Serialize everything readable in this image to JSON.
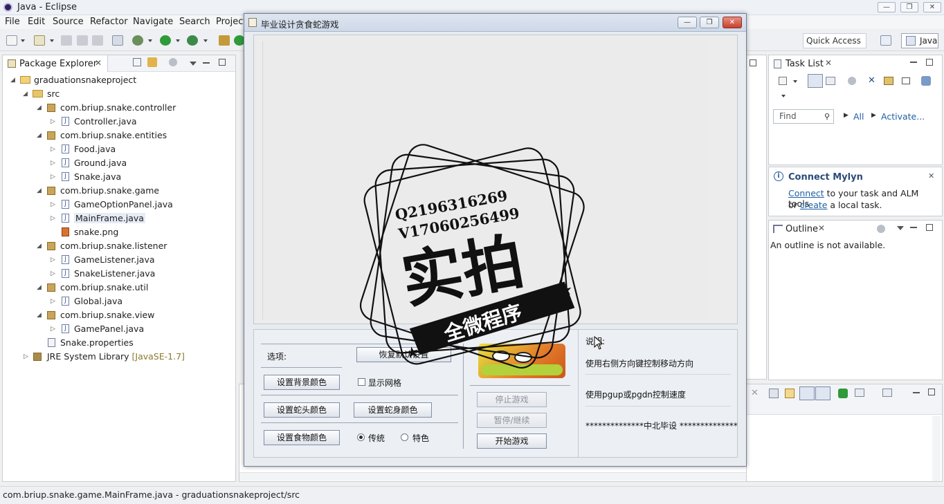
{
  "app": {
    "window_title": "Java - Eclipse",
    "menu": [
      "File",
      "Edit",
      "Source",
      "Refactor",
      "Navigate",
      "Search",
      "Project"
    ],
    "quick_access": "Quick Access",
    "perspective": "Java"
  },
  "package_explorer": {
    "title": "Package Explorer",
    "tree": [
      {
        "label": "graduationsnakeproject",
        "level": 0,
        "kind": "project"
      },
      {
        "label": "src",
        "level": 1,
        "kind": "folder"
      },
      {
        "label": "com.briup.snake.controller",
        "level": 2,
        "kind": "package"
      },
      {
        "label": "Controller.java",
        "level": 3,
        "kind": "java"
      },
      {
        "label": "com.briup.snake.entities",
        "level": 2,
        "kind": "package"
      },
      {
        "label": "Food.java",
        "level": 3,
        "kind": "java"
      },
      {
        "label": "Ground.java",
        "level": 3,
        "kind": "java"
      },
      {
        "label": "Snake.java",
        "level": 3,
        "kind": "java"
      },
      {
        "label": "com.briup.snake.game",
        "level": 2,
        "kind": "package"
      },
      {
        "label": "GameOptionPanel.java",
        "level": 3,
        "kind": "java"
      },
      {
        "label": "MainFrame.java",
        "level": 3,
        "kind": "java"
      },
      {
        "label": "snake.png",
        "level": 3,
        "kind": "image"
      },
      {
        "label": "com.briup.snake.listener",
        "level": 2,
        "kind": "package"
      },
      {
        "label": "GameListener.java",
        "level": 3,
        "kind": "java"
      },
      {
        "label": "SnakeListener.java",
        "level": 3,
        "kind": "java"
      },
      {
        "label": "com.briup.snake.util",
        "level": 2,
        "kind": "package"
      },
      {
        "label": "Global.java",
        "level": 3,
        "kind": "java"
      },
      {
        "label": "com.briup.snake.view",
        "level": 2,
        "kind": "package"
      },
      {
        "label": "GamePanel.java",
        "level": 3,
        "kind": "java"
      },
      {
        "label": "Snake.properties",
        "level": 2,
        "kind": "file"
      },
      {
        "label": "JRE System Library",
        "suffix": "[JavaSE-1.7]",
        "level": 1,
        "kind": "library"
      }
    ]
  },
  "task_list": {
    "title": "Task List",
    "find_placeholder": "Find",
    "all": "All",
    "activate": "Activate..."
  },
  "mylyn": {
    "title": "Connect Mylyn",
    "connect": "Connect",
    "text1": " to your task and ALM tools",
    "text2_pre": "or ",
    "create": "create",
    "text2_post": " a local task."
  },
  "outline": {
    "title": "Outline",
    "empty": "An outline is not available."
  },
  "status_bar": "com.briup.snake.game.MainFrame.java - graduationsnakeproject/src",
  "dialog": {
    "title": "毕业设计贪食蛇游戏",
    "options_label": "选项:",
    "restore_defaults": "恢复默认设置",
    "bg_color": "设置背景颜色",
    "show_grid": "显示网格",
    "head_color": "设置蛇头颜色",
    "body_color": "设置蛇身颜色",
    "food_color": "设置食物颜色",
    "radio_classic": "传统",
    "radio_special": "特色",
    "stop": "停止游戏",
    "pause": "暂停/继续",
    "start": "开始游戏",
    "desc_title": "说明:",
    "desc_line1": "使用右侧方向键控制移动方向",
    "desc_line2": "使用pgup或pgdn控制速度",
    "desc_line3": "**************中北毕设 **************"
  },
  "watermark": {
    "line1": "Q2196316269",
    "line2": "V17060256499",
    "main": "实拍",
    "ribbon": "全微程序"
  },
  "colors": {
    "accent_link": "#1f5fa6",
    "dialog_close": "#c6402c"
  }
}
